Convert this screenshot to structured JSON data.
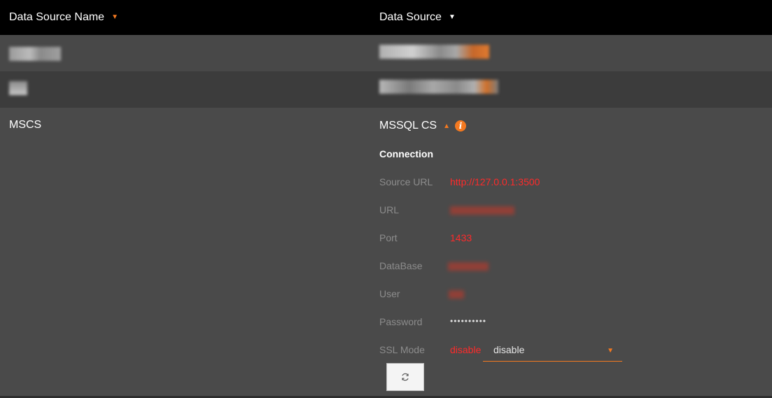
{
  "header": {
    "col1_label": "Data Source Name",
    "col1_caret": "▼",
    "col2_label": "Data Source",
    "col2_caret": "▼"
  },
  "row": {
    "name": "MSCS",
    "datasource": "MSSQL CS",
    "expand_caret": "▲",
    "info_glyph": "i",
    "connection_heading": "Connection",
    "fields": [
      {
        "label": "Source URL",
        "value": "http://127.0.0.1:3500"
      },
      {
        "label": "URL",
        "value": ""
      },
      {
        "label": "Port",
        "value": "1433"
      },
      {
        "label": "DataBase",
        "value": ""
      },
      {
        "label": "User",
        "value": ""
      },
      {
        "label": "Password",
        "value": "••••••••••"
      },
      {
        "label": "SSL Mode",
        "value": "disable"
      }
    ],
    "ssl_select": {
      "value": "disable",
      "arrow": "▼"
    }
  },
  "colors": {
    "accent": "#f47920",
    "value_red": "#ff2a2a",
    "header_bg": "#000000"
  }
}
